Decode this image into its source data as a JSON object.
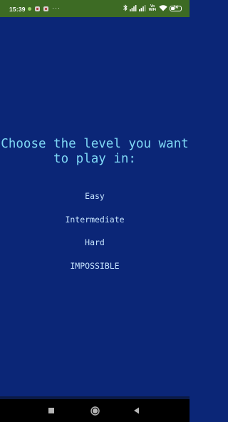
{
  "status_bar": {
    "time": "15:39",
    "left_icons": [
      "notification-dot-icon",
      "app-notification-icon",
      "app-notification-icon",
      "more-notifications-icon"
    ],
    "more_label": "···",
    "network_label": "Vo WiFi",
    "battery_level": "24",
    "right_icons": [
      "bluetooth-icon",
      "signal-icon",
      "signal-icon",
      "wifi-icon",
      "battery-icon"
    ]
  },
  "main": {
    "title": "Choose the level you want to play in:",
    "levels": [
      {
        "label": "Easy"
      },
      {
        "label": "Intermediate"
      },
      {
        "label": "Hard"
      },
      {
        "label": "IMPOSSIBLE"
      }
    ]
  },
  "nav_bar": {
    "buttons": [
      "recents-icon",
      "home-icon",
      "back-icon"
    ]
  },
  "colors": {
    "background": "#0b2677",
    "status_bar": "#3d6b24",
    "title_text": "#7fd8f5",
    "level_text": "#c8e6ff",
    "nav_bar": "#000000"
  }
}
